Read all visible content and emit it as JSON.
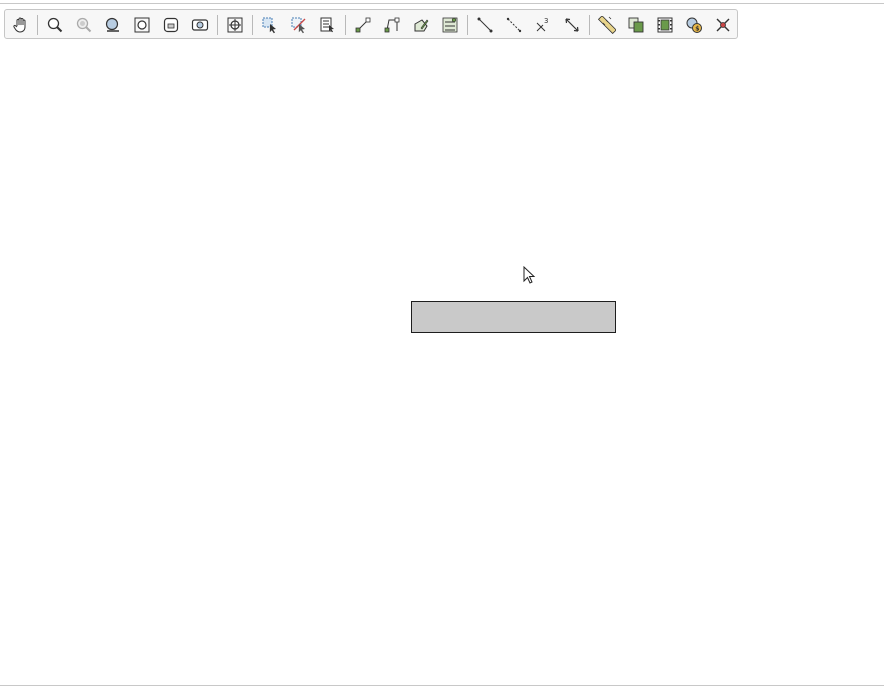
{
  "toolbar": {
    "name": "map-navigation-toolbar",
    "tools": [
      {
        "name": "pan-icon"
      },
      {
        "name": "zoom-in-icon"
      },
      {
        "name": "zoom-out-icon"
      },
      {
        "name": "zoom-to-selection-icon"
      },
      {
        "name": "zoom-full-icon"
      },
      {
        "name": "zoom-to-layer-icon"
      },
      {
        "name": "zoom-to-native-resolution-icon"
      },
      {
        "name": "pan-to-selection-icon"
      },
      {
        "name": "select-features-icon"
      },
      {
        "name": "deselect-features-icon"
      },
      {
        "name": "select-by-expression-icon"
      },
      {
        "name": "digitize-point-icon"
      },
      {
        "name": "digitize-line-icon"
      },
      {
        "name": "digitize-polygon-icon"
      },
      {
        "name": "vertex-tool-icon"
      },
      {
        "name": "measure-line-icon"
      },
      {
        "name": "measure-segment-icon"
      },
      {
        "name": "measure-3d-icon"
      },
      {
        "name": "measure-distance-icon"
      },
      {
        "name": "ruler-icon"
      },
      {
        "name": "copy-features-icon"
      },
      {
        "name": "film-strip-icon"
      },
      {
        "name": "map-tips-icon"
      },
      {
        "name": "delete-selected-icon"
      }
    ]
  },
  "canvas": {
    "box_fill": "#c9c9c9",
    "box_border": "#1e1e1e"
  },
  "colors": {
    "toolbar_bg": "#f7f7f7",
    "toolbar_border": "#c6c6c6",
    "icon_dark": "#333333",
    "icon_blue": "#4a7fb5",
    "icon_green": "#6a9a4a",
    "icon_red": "#c84646"
  }
}
